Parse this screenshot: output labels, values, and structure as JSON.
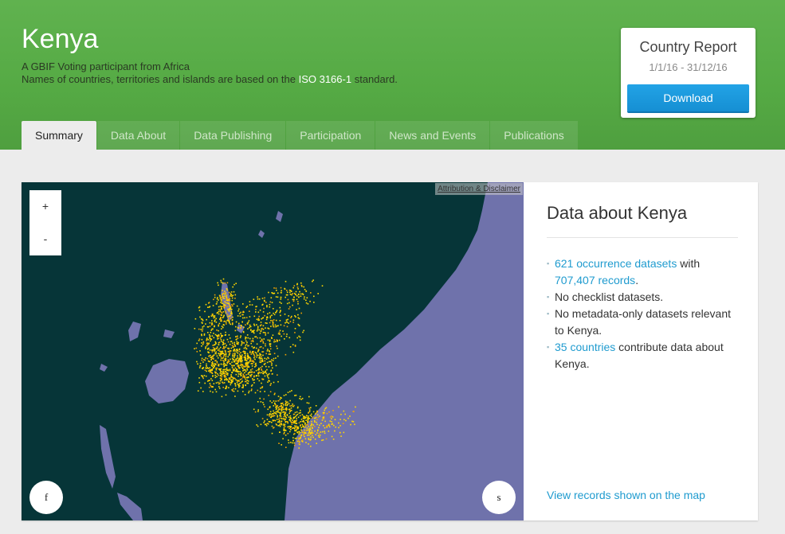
{
  "header": {
    "title": "Kenya",
    "subtitle_line1": "A GBIF Voting participant from Africa",
    "subtitle_line2_prefix": "Names of countries, territories and islands are based on the",
    "subtitle_line2_link": "ISO 3166-1",
    "subtitle_line2_suffix": "standard."
  },
  "report": {
    "title": "Country Report",
    "date_range": "1/1/16 - 31/12/16",
    "download_label": "Download"
  },
  "tabs": [
    {
      "label": "Summary",
      "active": true
    },
    {
      "label": "Data About",
      "active": false
    },
    {
      "label": "Data Publishing",
      "active": false
    },
    {
      "label": "Participation",
      "active": false
    },
    {
      "label": "News and Events",
      "active": false
    },
    {
      "label": "Publications",
      "active": false
    }
  ],
  "map": {
    "attribution": "Attribution & Disclaimer",
    "zoom_in": "+",
    "zoom_out": "-",
    "left_button": "f",
    "right_button": "s",
    "land_color": "#063538",
    "water_color": "#6f72ab",
    "point_color": "#ffd700"
  },
  "sidebar": {
    "title": "Data about Kenya",
    "fact1_link1": "621 occurrence datasets",
    "fact1_mid": "with",
    "fact1_link2": "707,407 records",
    "fact1_end": ".",
    "fact2": "No checklist datasets.",
    "fact3": "No metadata-only datasets relevant to Kenya.",
    "fact4_link": "35 countries",
    "fact4_rest": "contribute data about Kenya.",
    "view_link": "View records shown on the map"
  }
}
